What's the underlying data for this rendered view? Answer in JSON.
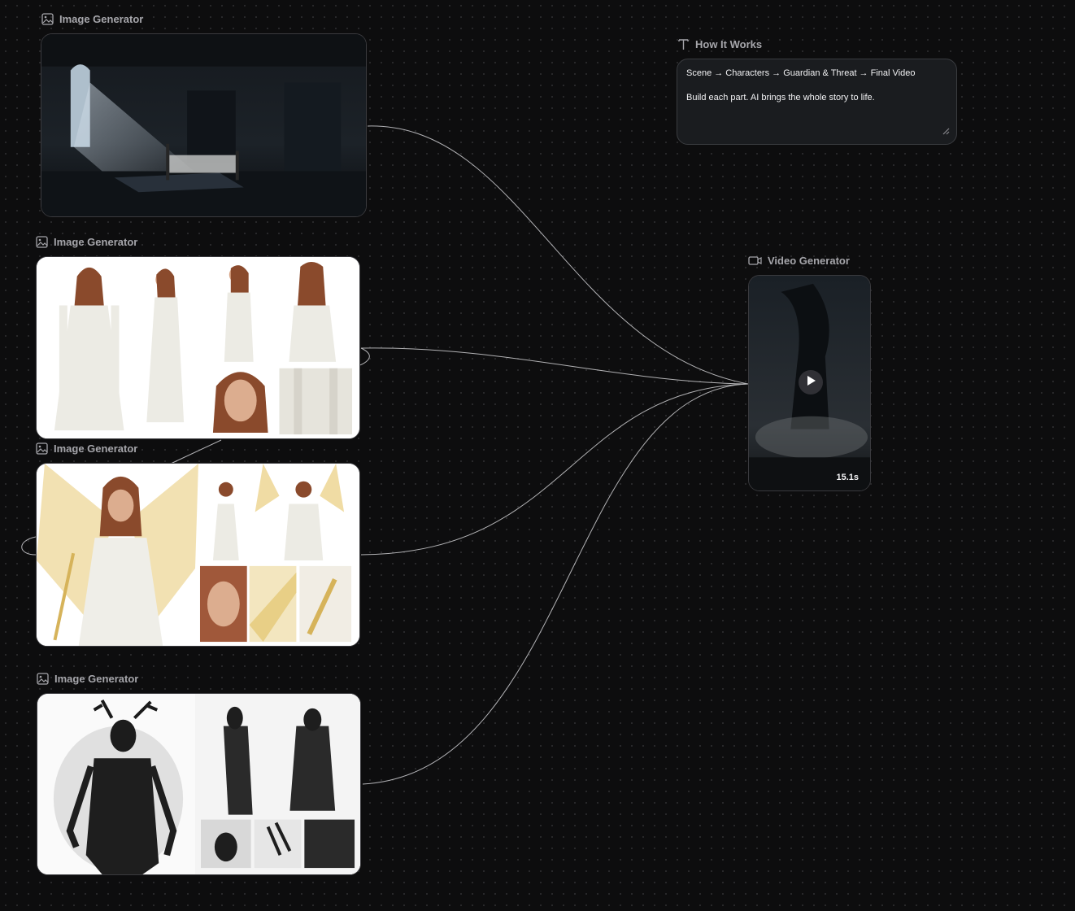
{
  "nodes": {
    "scene": {
      "title": "Image Generator",
      "icon": "image-icon"
    },
    "characters": {
      "title": "Image Generator",
      "icon": "image-icon"
    },
    "guardian": {
      "title": "Image Generator",
      "icon": "image-icon"
    },
    "threat": {
      "title": "Image Generator",
      "icon": "image-icon"
    },
    "how_it_works": {
      "title": "How It Works",
      "icon": "text-icon",
      "line1": "Scene → Characters → Guardian & Threat → Final Video",
      "line2": "Build each part. AI brings the whole story to life."
    },
    "video": {
      "title": "Video Generator",
      "icon": "video-icon",
      "duration": "15.1s"
    }
  },
  "colors": {
    "background": "#0d0d0e",
    "edge": "#cfcfd2",
    "label": "#a6a6ab"
  }
}
